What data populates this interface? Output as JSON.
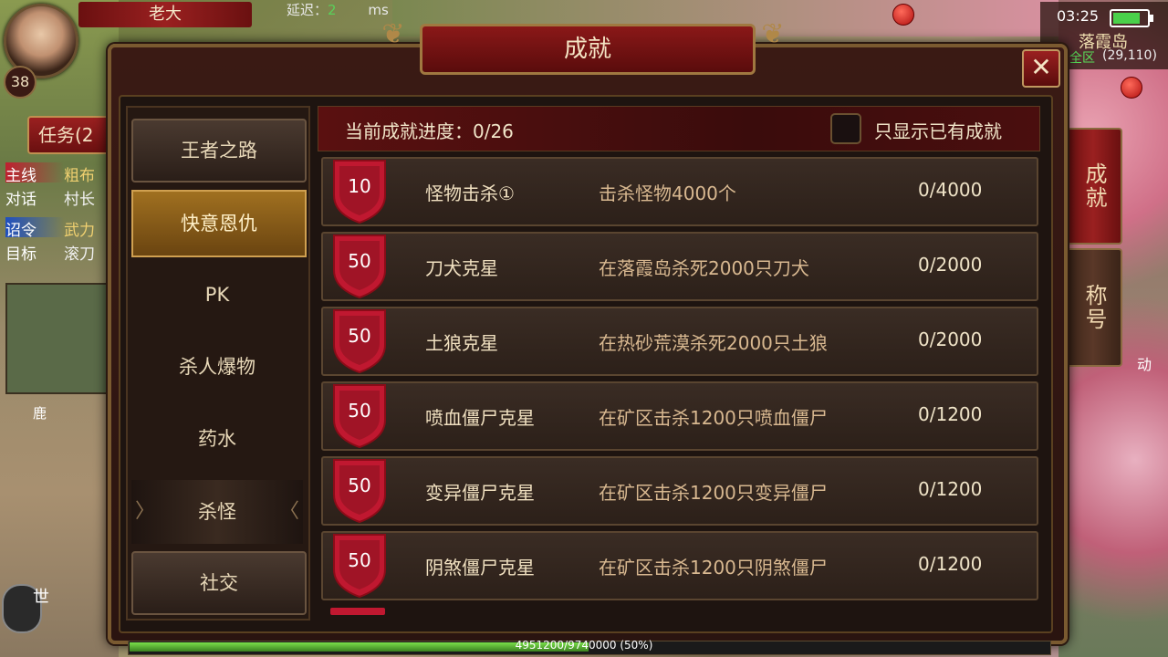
{
  "hud": {
    "player_name": "老大",
    "level": "38",
    "latency_label": "延迟：",
    "latency_value": "2",
    "latency_unit": "ms",
    "task_button": "任务(2",
    "quests": [
      {
        "tag": "主线",
        "text": "粗布"
      },
      {
        "tag": "对话",
        "text": "村长"
      },
      {
        "tag": "诏令",
        "text": "武力"
      },
      {
        "tag": "目标",
        "text": "滚刀"
      }
    ],
    "deer_label": "鹿",
    "chat_label": "世",
    "clock": "03:25",
    "battery_percent": 80,
    "map_name": "落霞岛",
    "map_zone": "全区",
    "map_coord": "(29,110)",
    "auto_label": "动",
    "exp_text": "4951200/9740000 (50%)",
    "exp_fraction": 0.5
  },
  "side_tabs": [
    "成就",
    "称号"
  ],
  "dialog": {
    "title": "成就",
    "close": "✕",
    "progress_label": "当前成就进度：0/26",
    "filter_label": "只显示已有成就"
  },
  "nav": [
    {
      "label": "王者之路"
    },
    {
      "label": "快意恩仇"
    },
    {
      "label": "PK"
    },
    {
      "label": "杀人爆物"
    },
    {
      "label": "药水"
    },
    {
      "label": "杀怪"
    },
    {
      "label": "社交"
    }
  ],
  "achievements": [
    {
      "points": "10",
      "name": "怪物击杀①",
      "desc": "击杀怪物4000个",
      "progress": "0/4000"
    },
    {
      "points": "50",
      "name": "刀犬克星",
      "desc": "在落霞岛杀死2000只刀犬",
      "progress": "0/2000"
    },
    {
      "points": "50",
      "name": "土狼克星",
      "desc": "在热砂荒漠杀死2000只土狼",
      "progress": "0/2000"
    },
    {
      "points": "50",
      "name": "喷血僵尸克星",
      "desc": "在矿区击杀1200只喷血僵尸",
      "progress": "0/1200"
    },
    {
      "points": "50",
      "name": "变异僵尸克星",
      "desc": "在矿区击杀1200只变异僵尸",
      "progress": "0/1200"
    },
    {
      "points": "50",
      "name": "阴煞僵尸克星",
      "desc": "在矿区击杀1200只阴煞僵尸",
      "progress": "0/1200"
    }
  ],
  "colors": {
    "accent_red": "#9a2020",
    "gold": "#c09050",
    "badge_red": "#c01830"
  }
}
